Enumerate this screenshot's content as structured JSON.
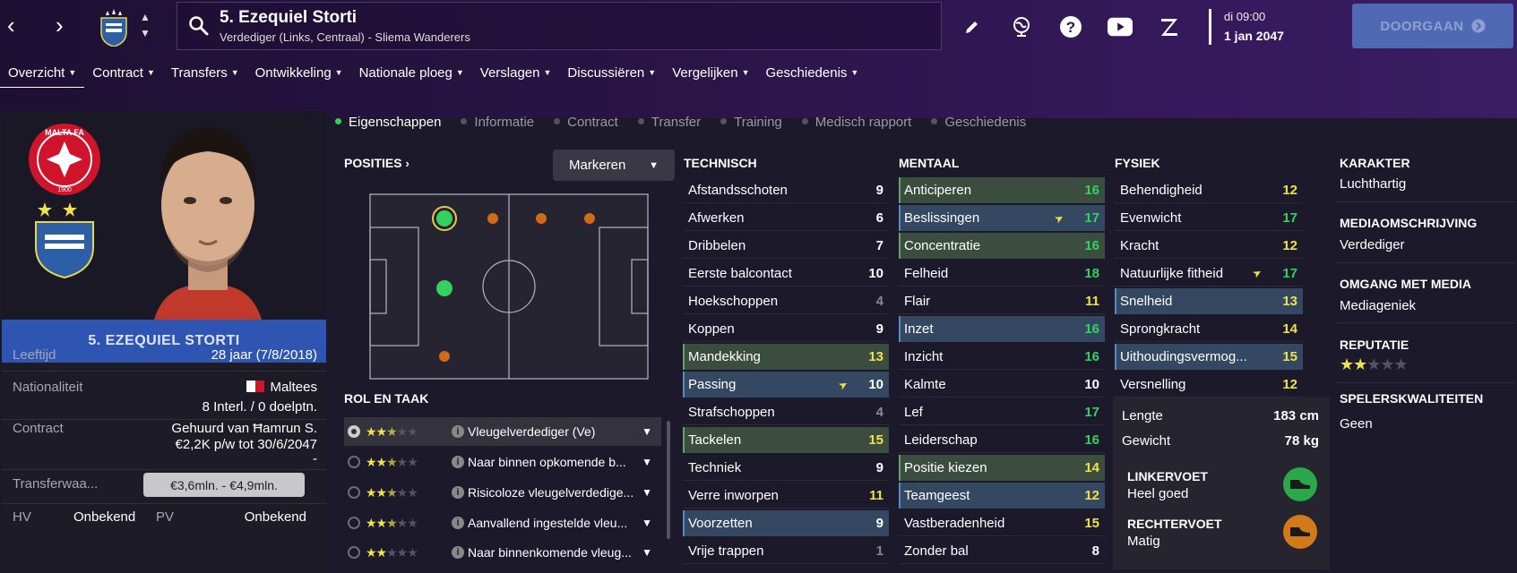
{
  "header": {
    "player_name": "5. Ezequiel Storti",
    "player_subtitle": "Verdediger (Links, Centraal) - Sliema Wanderers",
    "date_day": "di 09:00",
    "date_full": "1 jan 2047",
    "continue_label": "DOORGAAN",
    "icons": [
      "back-icon",
      "forward-icon",
      "search-icon",
      "pencil-icon",
      "globe-icon",
      "help-icon",
      "youtube-icon",
      "z-icon",
      "continue-icon"
    ]
  },
  "nav": {
    "items": [
      {
        "label": "Overzicht"
      },
      {
        "label": "Contract"
      },
      {
        "label": "Transfers"
      },
      {
        "label": "Ontwikkeling"
      },
      {
        "label": "Nationale ploeg"
      },
      {
        "label": "Verslagen"
      },
      {
        "label": "Discussiëren"
      },
      {
        "label": "Vergelijken"
      },
      {
        "label": "Geschiedenis"
      }
    ]
  },
  "profile": {
    "name_banner": "5. EZEQUIEL STORTI",
    "age_label": "Leeftijd",
    "age_value": "28 jaar (7/8/2018)",
    "nat_label": "Nationaliteit",
    "nat_value": "Maltees",
    "nat_caps": "8 Interl. / 0 doelptn.",
    "contract_label": "Contract",
    "contract_line1": "Gehuurd van Ħamrun S.",
    "contract_line2": "€2,2K p/w tot 30/6/2047",
    "contract_line3": "-",
    "value_label": "Transferwaa...",
    "value_range": "€3,6mln. - €4,9mln.",
    "hv_label": "HV",
    "hv_value": "Onbekend",
    "pv_label": "PV",
    "pv_value": "Onbekend",
    "flag_colors": [
      "#ffffff",
      "#cf142b"
    ],
    "malta_fa_text": "MALTA FA",
    "malta_fa_year": "1900"
  },
  "subtabs": [
    {
      "label": "Eigenschappen"
    },
    {
      "label": "Informatie"
    },
    {
      "label": "Contract"
    },
    {
      "label": "Transfer"
    },
    {
      "label": "Training"
    },
    {
      "label": "Medisch rapport"
    },
    {
      "label": "Geschiedenis"
    }
  ],
  "positions": {
    "heading": "POSITIES",
    "marker_label": "Markeren"
  },
  "roles": {
    "heading": "ROL EN TAAK",
    "items": [
      {
        "name": "Vleugelverdediger (Ve)",
        "stars": 2.5
      },
      {
        "name": "Naar binnen opkomende b...",
        "stars": 2.5
      },
      {
        "name": "Risicoloze vleugelverdedige...",
        "stars": 2.5
      },
      {
        "name": "Aanvallend ingestelde vleu...",
        "stars": 2.5
      },
      {
        "name": "Naar binnenkomende vleug...",
        "stars": 2
      }
    ]
  },
  "technical": {
    "heading": "TECHNISCH",
    "items": [
      {
        "name": "Afstandsschoten",
        "value": 9
      },
      {
        "name": "Afwerken",
        "value": 6
      },
      {
        "name": "Dribbelen",
        "value": 7
      },
      {
        "name": "Eerste balcontact",
        "value": 10
      },
      {
        "name": "Hoekschoppen",
        "value": 4
      },
      {
        "name": "Koppen",
        "value": 9
      },
      {
        "name": "Mandekking",
        "value": 13
      },
      {
        "name": "Passing",
        "value": 10
      },
      {
        "name": "Strafschoppen",
        "value": 4
      },
      {
        "name": "Tackelen",
        "value": 15
      },
      {
        "name": "Techniek",
        "value": 9
      },
      {
        "name": "Verre inworpen",
        "value": 11
      },
      {
        "name": "Voorzetten",
        "value": 9
      },
      {
        "name": "Vrije trappen",
        "value": 1
      }
    ]
  },
  "mental": {
    "heading": "MENTAAL",
    "items": [
      {
        "name": "Anticiperen",
        "value": 16
      },
      {
        "name": "Beslissingen",
        "value": 17
      },
      {
        "name": "Concentratie",
        "value": 16
      },
      {
        "name": "Felheid",
        "value": 18
      },
      {
        "name": "Flair",
        "value": 11
      },
      {
        "name": "Inzet",
        "value": 16
      },
      {
        "name": "Inzicht",
        "value": 16
      },
      {
        "name": "Kalmte",
        "value": 10
      },
      {
        "name": "Lef",
        "value": 17
      },
      {
        "name": "Leiderschap",
        "value": 16
      },
      {
        "name": "Positie kiezen",
        "value": 14
      },
      {
        "name": "Teamgeest",
        "value": 12
      },
      {
        "name": "Vastberadenheid",
        "value": 15
      },
      {
        "name": "Zonder bal",
        "value": 8
      }
    ]
  },
  "physical": {
    "heading": "FYSIEK",
    "items": [
      {
        "name": "Behendigheid",
        "value": 12
      },
      {
        "name": "Evenwicht",
        "value": 17
      },
      {
        "name": "Kracht",
        "value": 12
      },
      {
        "name": "Natuurlijke fitheid",
        "value": 17
      },
      {
        "name": "Snelheid",
        "value": 13
      },
      {
        "name": "Sprongkracht",
        "value": 14
      },
      {
        "name": "Uithoudingsvermog...",
        "value": 15
      },
      {
        "name": "Versnelling",
        "value": 12
      }
    ],
    "length_label": "Lengte",
    "length_value": "183 cm",
    "weight_label": "Gewicht",
    "weight_value": "78 kg",
    "left_foot_label": "LINKERVOET",
    "left_foot_value": "Heel goed",
    "left_foot_color": "#2aa84a",
    "right_foot_label": "RECHTERVOET",
    "right_foot_value": "Matig",
    "right_foot_color": "#d27a18"
  },
  "right": {
    "karakter_label": "KARAKTER",
    "karakter_value": "Luchthartig",
    "media_desc_label": "MEDIAOMSCHRIJVING",
    "media_desc_value": "Verdediger",
    "media_handling_label": "OMGANG MET MEDIA",
    "media_handling_value": "Mediageniek",
    "reputation_label": "REPUTATIE",
    "reputation_stars": 2,
    "qualities_label": "SPELERSKWALITEITEN",
    "qualities_value": "Geen"
  },
  "colors": {
    "accent": "#2f55b2",
    "highlight_green": "#33d25e",
    "highlight_yellow": "#f0e24a"
  }
}
